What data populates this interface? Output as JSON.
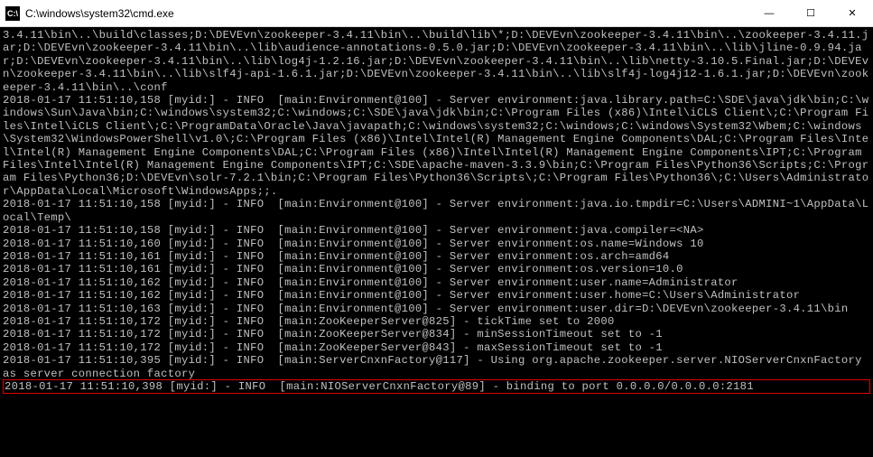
{
  "titlebar": {
    "icon_label": "C:\\",
    "title": "C:\\windows\\system32\\cmd.exe"
  },
  "win_controls": {
    "minimize": "—",
    "maximize": "☐",
    "close": "✕"
  },
  "console": {
    "pre": "3.4.11\\bin\\..\\build\\classes;D:\\DEVEvn\\zookeeper-3.4.11\\bin\\..\\build\\lib\\*;D:\\DEVEvn\\zookeeper-3.4.11\\bin\\..\\zookeeper-3.4.11.jar;D:\\DEVEvn\\zookeeper-3.4.11\\bin\\..\\lib\\audience-annotations-0.5.0.jar;D:\\DEVEvn\\zookeeper-3.4.11\\bin\\..\\lib\\jline-0.9.94.jar;D:\\DEVEvn\\zookeeper-3.4.11\\bin\\..\\lib\\log4j-1.2.16.jar;D:\\DEVEvn\\zookeeper-3.4.11\\bin\\..\\lib\\netty-3.10.5.Final.jar;D:\\DEVEvn\\zookeeper-3.4.11\\bin\\..\\lib\\slf4j-api-1.6.1.jar;D:\\DEVEvn\\zookeeper-3.4.11\\bin\\..\\lib\\slf4j-log4j12-1.6.1.jar;D:\\DEVEvn\\zookeeper-3.4.11\\bin\\..\\conf\n2018-01-17 11:51:10,158 [myid:] - INFO  [main:Environment@100] - Server environment:java.library.path=C:\\SDE\\java\\jdk\\bin;C:\\windows\\Sun\\Java\\bin;C:\\windows\\system32;C:\\windows;C:\\SDE\\java\\jdk\\bin;C:\\Program Files (x86)\\Intel\\iCLS Client\\;C:\\Program Files\\Intel\\iCLS Client\\;C:\\ProgramData\\Oracle\\Java\\javapath;C:\\windows\\system32;C:\\windows;C:\\windows\\System32\\Wbem;C:\\windows\\System32\\WindowsPowerShell\\v1.0\\;C:\\Program Files (x86)\\Intel\\Intel(R) Management Engine Components\\DAL;C:\\Program Files\\Intel\\Intel(R) Management Engine Components\\DAL;C:\\Program Files (x86)\\Intel\\Intel(R) Management Engine Components\\IPT;C:\\Program Files\\Intel\\Intel(R) Management Engine Components\\IPT;C:\\SDE\\apache-maven-3.3.9\\bin;C:\\Program Files\\Python36\\Scripts;C:\\Program Files\\Python36;D:\\DEVEvn\\solr-7.2.1\\bin;C:\\Program Files\\Python36\\Scripts\\;C:\\Program Files\\Python36\\;C:\\Users\\Administrator\\AppData\\Local\\Microsoft\\WindowsApps;;.\n2018-01-17 11:51:10,158 [myid:] - INFO  [main:Environment@100] - Server environment:java.io.tmpdir=C:\\Users\\ADMINI~1\\AppData\\Local\\Temp\\\n2018-01-17 11:51:10,158 [myid:] - INFO  [main:Environment@100] - Server environment:java.compiler=<NA>\n2018-01-17 11:51:10,160 [myid:] - INFO  [main:Environment@100] - Server environment:os.name=Windows 10\n2018-01-17 11:51:10,161 [myid:] - INFO  [main:Environment@100] - Server environment:os.arch=amd64\n2018-01-17 11:51:10,161 [myid:] - INFO  [main:Environment@100] - Server environment:os.version=10.0\n2018-01-17 11:51:10,162 [myid:] - INFO  [main:Environment@100] - Server environment:user.name=Administrator\n2018-01-17 11:51:10,162 [myid:] - INFO  [main:Environment@100] - Server environment:user.home=C:\\Users\\Administrator\n2018-01-17 11:51:10,163 [myid:] - INFO  [main:Environment@100] - Server environment:user.dir=D:\\DEVEvn\\zookeeper-3.4.11\\bin\n2018-01-17 11:51:10,172 [myid:] - INFO  [main:ZooKeeperServer@825] - tickTime set to 2000\n2018-01-17 11:51:10,172 [myid:] - INFO  [main:ZooKeeperServer@834] - minSessionTimeout set to -1\n2018-01-17 11:51:10,172 [myid:] - INFO  [main:ZooKeeperServer@843] - maxSessionTimeout set to -1\n2018-01-17 11:51:10,395 [myid:] - INFO  [main:ServerCnxnFactory@117] - Using org.apache.zookeeper.server.NIOServerCnxnFactory as server connection factory",
    "highlighted": "2018-01-17 11:51:10,398 [myid:] - INFO  [main:NIOServerCnxnFactory@89] - binding to port 0.0.0.0/0.0.0.0:2181"
  }
}
